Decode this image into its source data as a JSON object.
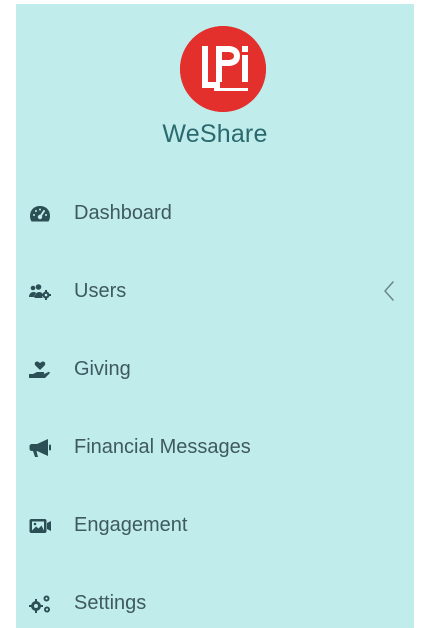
{
  "brand": {
    "logo_text": "LPi",
    "app_name": "WeShare",
    "logo_color": "#e3302c"
  },
  "colors": {
    "sidebar_bg": "#c0ecec",
    "text": "#3f5a5e",
    "icon": "#2b4f54"
  },
  "menu": {
    "items": [
      {
        "label": "Dashboard",
        "icon": "tachometer-icon"
      },
      {
        "label": "Users",
        "icon": "users-cog-icon",
        "has_submenu": true
      },
      {
        "label": "Giving",
        "icon": "hand-holding-heart-icon"
      },
      {
        "label": "Financial Messages",
        "icon": "bullhorn-icon"
      },
      {
        "label": "Engagement",
        "icon": "photo-video-icon"
      },
      {
        "label": "Settings",
        "icon": "cogs-icon"
      }
    ]
  }
}
